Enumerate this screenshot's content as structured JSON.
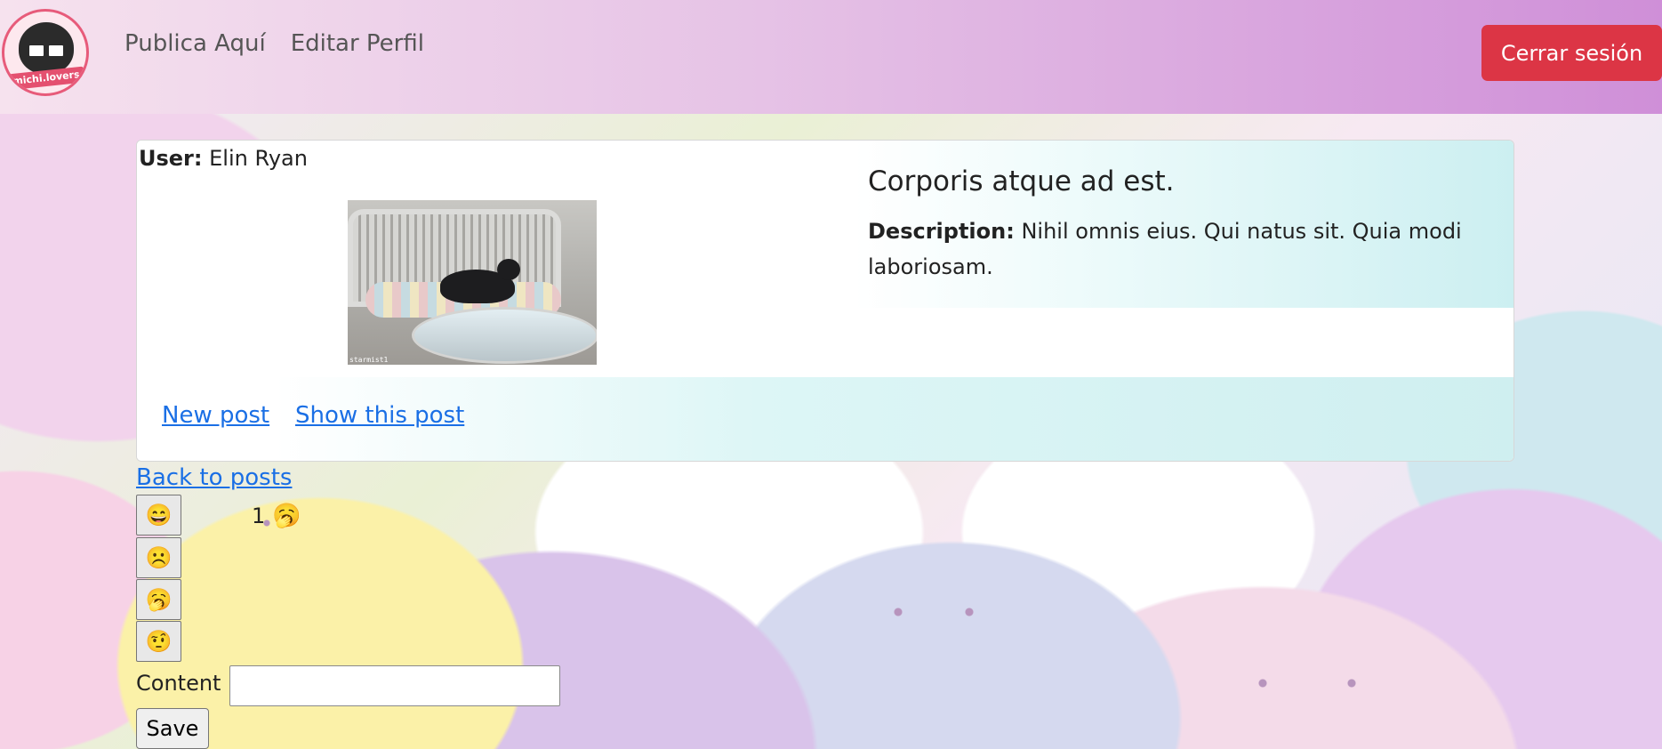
{
  "navbar": {
    "logo_text": "michi.lovers",
    "links": [
      "Publica Aquí",
      "Editar Perfil"
    ],
    "logout_label": "Cerrar sesión",
    "logout_color": "#dc3545"
  },
  "post": {
    "user_label": "User:",
    "user_name": "Elin Ryan",
    "image_caption": "starmist1",
    "title": "Corporis atque ad est.",
    "description_label": "Description:",
    "description": "Nihil omnis eius. Qui natus sit. Quia modi laboriosam.",
    "footer_links": [
      "New post",
      "Show this post"
    ]
  },
  "back_link": "Back to posts",
  "reactions": {
    "buttons": [
      {
        "icon": "grinning-face-icon",
        "glyph": "😄"
      },
      {
        "icon": "frowning-face-icon",
        "glyph": "☹️"
      },
      {
        "icon": "yawning-face-icon",
        "glyph": "🥱"
      },
      {
        "icon": "face-with-raised-eyebrow-icon",
        "glyph": "🤨"
      }
    ],
    "summary": {
      "count": "1",
      "glyph": "🥱",
      "icon": "yawning-face-icon"
    }
  },
  "comment_form": {
    "content_label": "Content",
    "content_value": "",
    "save_label": "Save"
  },
  "colors": {
    "link": "#1a6fe5",
    "navbar_start": "#f6e2ee",
    "navbar_end": "#cf8fd8"
  }
}
